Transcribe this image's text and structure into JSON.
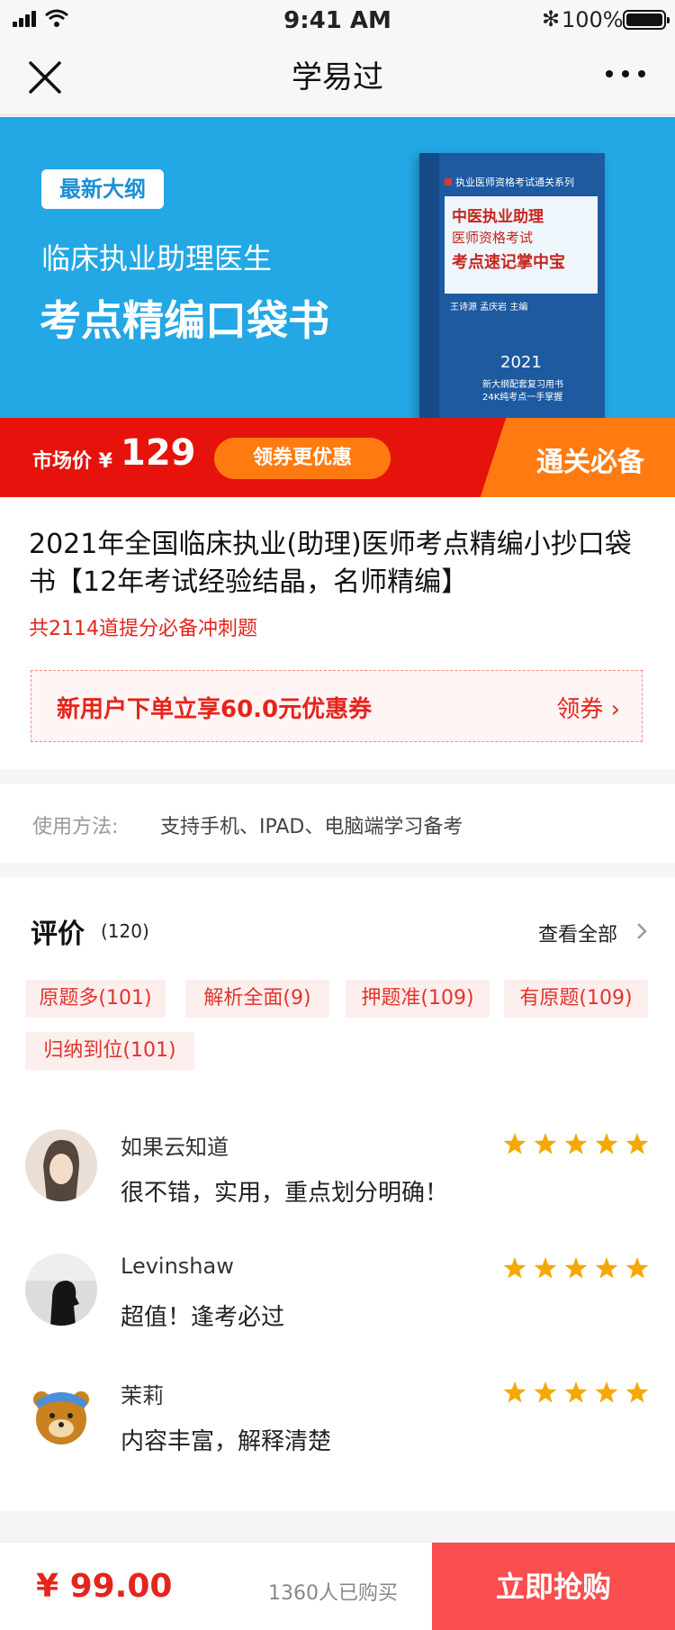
{
  "status_bar": {
    "time": "9:41 AM",
    "battery": "100%",
    "bluetooth_glyph": "✻"
  },
  "nav": {
    "title": "学易过",
    "close_icon": "close-icon",
    "more_icon": "more-icon"
  },
  "banner": {
    "tag": "最新大纲",
    "subtitle": "临床执业助理医生",
    "title": "考点精编口袋书",
    "book": {
      "series": "执业医师资格考试通关系列",
      "title_line1": "中医执业助理",
      "title_line2": "医师资格考试",
      "title_line3": "考点速记掌中宝",
      "authors": "王诗源 孟庆岩 主编",
      "year": "2021",
      "line1": "新大纲配套复习用书",
      "line2": "24K纯考点一手掌握"
    }
  },
  "price_strip": {
    "market_label": "市场价 ¥",
    "market_price": "129",
    "coupon_btn": "领券更优惠",
    "badge": "通关必备"
  },
  "product": {
    "title": "2021年全国临床执业(助理)医师考点精编小抄口袋书【12年考试经验结晶，名师精编】",
    "subtitle": "共2114道提分必备冲刺题",
    "coupon_text": "新用户下单立享60.0元优惠券",
    "coupon_action": "领券 ›"
  },
  "usage": {
    "label": "使用方法:",
    "value": "支持手机、IPAD、电脑端学习备考"
  },
  "reviews": {
    "title": "评价",
    "count": "(120)",
    "view_all": "查看全部",
    "tags": [
      "原题多(101)",
      "解析全面(9)",
      "押题准(109)",
      "有原题(109)",
      "归纳到位(101)"
    ],
    "items": [
      {
        "name": "如果云知道",
        "text": "很不错，实用，重点划分明确！",
        "rating": 5
      },
      {
        "name": "Levinshaw",
        "text": "超值！逢考必过",
        "rating": 5
      },
      {
        "name": "茉莉",
        "text": "内容丰富，解释清楚",
        "rating": 5
      }
    ]
  },
  "bottom": {
    "price": "¥ 99.00",
    "buyers": "1360人已购买",
    "buy_button": "立即抢购"
  },
  "colors": {
    "accent_red": "#e5130b",
    "accent_orange": "#ff7b12",
    "banner_blue": "#23a7e5",
    "star": "#f5a800"
  }
}
